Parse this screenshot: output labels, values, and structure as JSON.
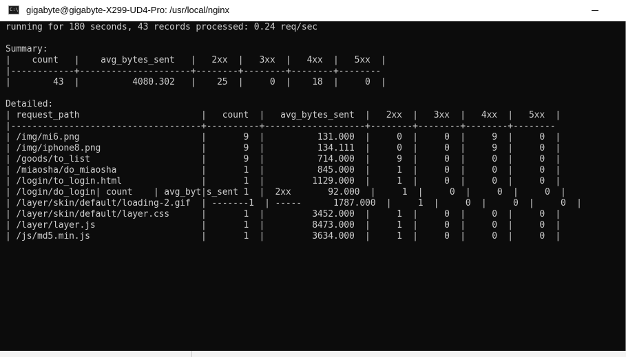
{
  "window": {
    "title": "gigabyte@gigabyte-X299-UD4-Pro: /usr/local/nginx",
    "icon": "C:\\"
  },
  "console": {
    "lines": [
      "running for 180 seconds, 43 records processed: 0.24 req/sec",
      "",
      "Summary:",
      "|    count   |    avg_bytes_sent   |   2xx  |   3xx  |   4xx  |   5xx  |",
      "|------------+---------------------+--------+--------+--------+--------",
      "|        43  |          4080.302   |    25  |     0  |    18  |     0  |",
      "",
      "Detailed:",
      "| request_path                       |   count  |   avg_bytes_sent  |   2xx  |   3xx  |   4xx  |   5xx  |",
      "|------------------------------------+----------+-------------------+--------+--------+--------+--------",
      "| /img/mi6.png                       |       9  |          131.000  |     0  |     0  |     9  |     0  |",
      "| /img/iphone8.png                   |       9  |          134.111  |     0  |     0  |     9  |     0  |",
      "| /goods/to_list                     |       9  |          714.000  |     9  |     0  |     0  |     0  |",
      "| /miaosha/do_miaosha                |       1  |          845.000  |     1  |     0  |     0  |     0  |",
      "| /login/to_login.html               |       1  |         1129.000  |     1  |     0  |     0  |     0  |",
      "| /login/do_login| count    | avg_byt|s_sent 1  |  2xx       92.000  |     1  |     0  |     0  |     0  |",
      "| /layer/skin/default/loading-2.gif  | -------1  | -----      1787.000  |     1  |     0  |     0  |     0  |",
      "| /layer/skin/default/layer.css      |       1  |         3452.000  |     1  |     0  |     0  |     0  |",
      "| /layer/layer.js                    |       1  |         8473.000  |     1  |     0  |     0  |     0  |",
      "| /js/md5.min.js                     |       1  |         3634.000  |     1  |     0  |     0  |     0  |"
    ]
  }
}
